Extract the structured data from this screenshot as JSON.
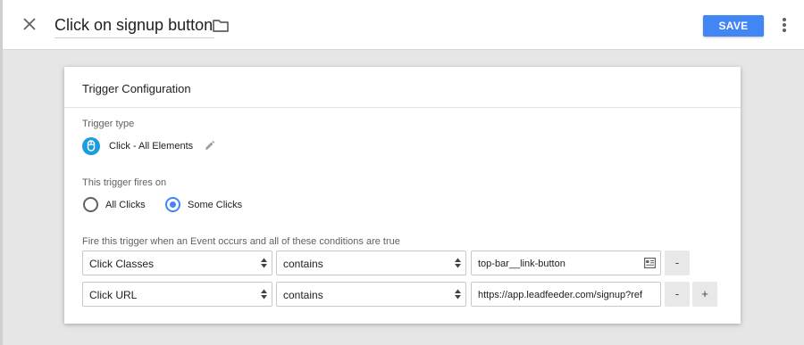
{
  "header": {
    "title": "Click on signup button",
    "save_label": "SAVE"
  },
  "card": {
    "title": "Trigger Configuration",
    "trigger_type_label": "Trigger type",
    "trigger_type_name": "Click - All Elements",
    "fires_on_label": "This trigger fires on",
    "radio_options": [
      {
        "label": "All Clicks",
        "selected": false
      },
      {
        "label": "Some Clicks",
        "selected": true
      }
    ],
    "conditions_label": "Fire this trigger when an Event occurs and all of these conditions are true",
    "conditions": [
      {
        "variable": "Click Classes",
        "operator": "contains",
        "value": "top-bar__link-button",
        "remove_label": "-"
      },
      {
        "variable": "Click URL",
        "operator": "contains",
        "value": "https://app.leadfeeder.com/signup?ref",
        "remove_label": "-",
        "add_label": "+"
      }
    ]
  },
  "colors": {
    "accent": "#4285f4",
    "trigger_icon": "#1e9dde",
    "page_bg": "#e6e6e6"
  },
  "icons": [
    "close-icon",
    "folder-icon",
    "more-vert-icon",
    "click-mouse-icon",
    "pencil-icon",
    "variable-picker-icon",
    "select-arrows-icon"
  ]
}
